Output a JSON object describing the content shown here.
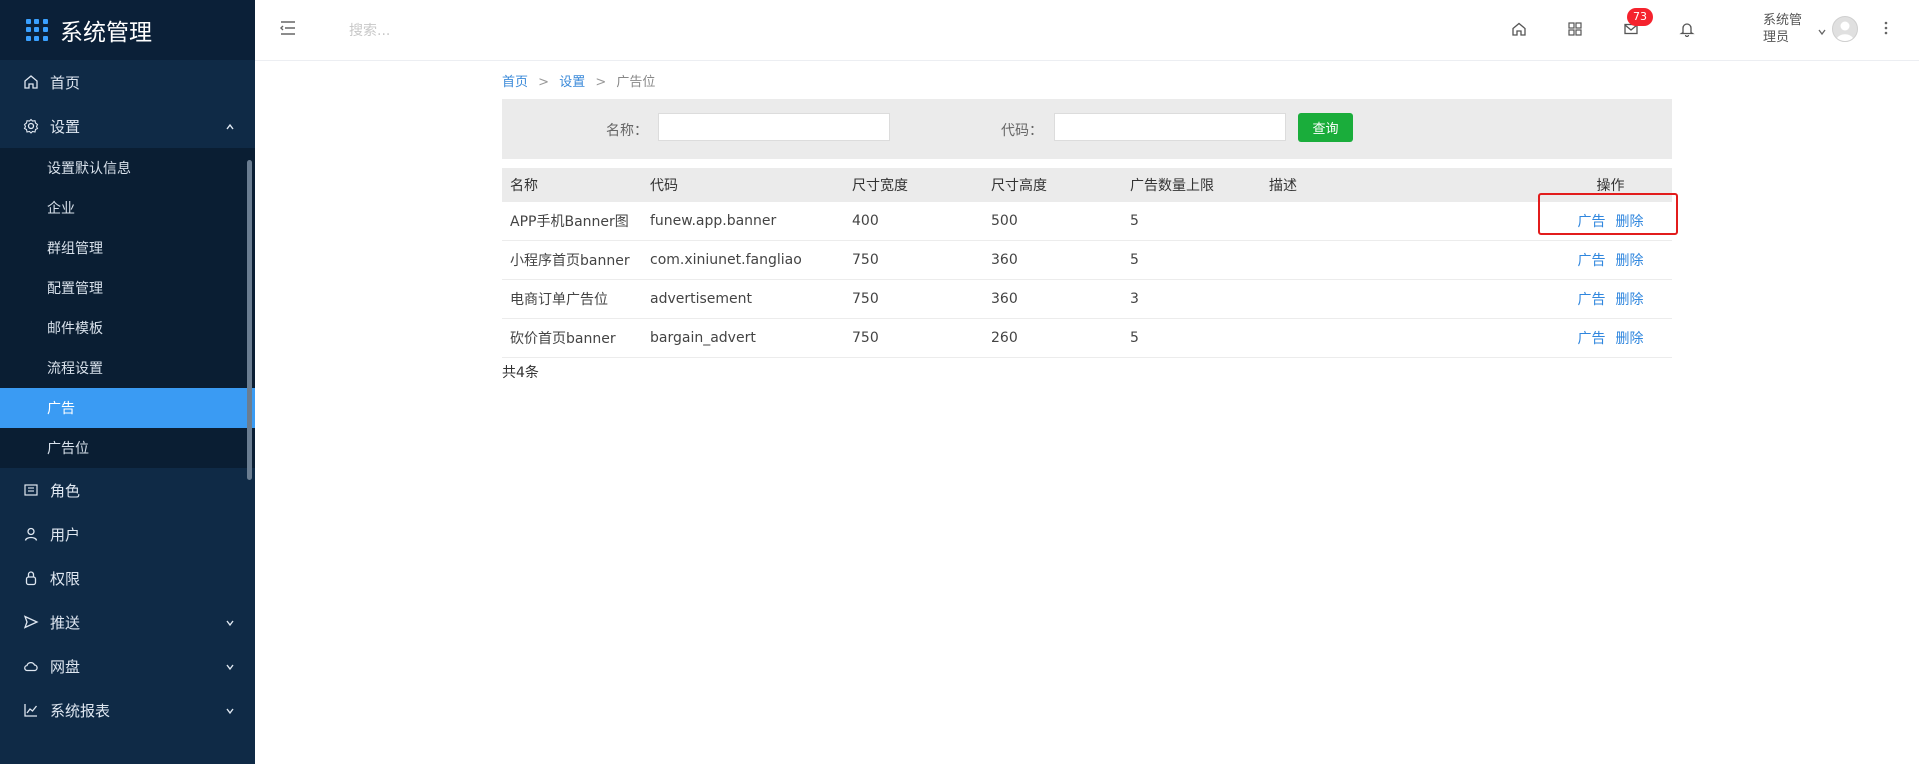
{
  "app": {
    "title": "系统管理"
  },
  "sidebar": {
    "items": [
      {
        "label": "首页",
        "icon": "home-icon"
      },
      {
        "label": "设置",
        "icon": "gear-icon",
        "expanded": true
      },
      {
        "label": "角色",
        "icon": "role-icon"
      },
      {
        "label": "用户",
        "icon": "user-icon"
      },
      {
        "label": "权限",
        "icon": "lock-icon"
      },
      {
        "label": "推送",
        "icon": "send-icon"
      },
      {
        "label": "网盘",
        "icon": "cloud-icon"
      },
      {
        "label": "系统报表",
        "icon": "chart-icon"
      }
    ],
    "settings_children": [
      {
        "label": "设置默认信息"
      },
      {
        "label": "企业"
      },
      {
        "label": "群组管理"
      },
      {
        "label": "配置管理"
      },
      {
        "label": "邮件模板"
      },
      {
        "label": "流程设置"
      },
      {
        "label": "广告",
        "active": true
      },
      {
        "label": "广告位"
      }
    ]
  },
  "header": {
    "search_placeholder": "搜索...",
    "mail_badge": "73",
    "user_name": "系统管理员",
    "icons": [
      "menu-toggle-icon",
      "home-icon",
      "apps-icon",
      "mail-icon",
      "bell-icon",
      "chevron-down-icon",
      "avatar",
      "more-vertical-icon"
    ]
  },
  "breadcrumb": {
    "home": "首页",
    "settings": "设置",
    "current": "广告位",
    "sep": ">"
  },
  "filter": {
    "name_label": "名称：",
    "code_label": "代码：",
    "name_value": "",
    "code_value": "",
    "query_button": "查询"
  },
  "table": {
    "columns": [
      "名称",
      "代码",
      "尺寸宽度",
      "尺寸高度",
      "广告数量上限",
      "描述",
      "操作"
    ],
    "rows": [
      {
        "name": "APP手机Banner图",
        "code": "funew.app.banner",
        "width": "400",
        "height": "500",
        "limit": "5",
        "desc": ""
      },
      {
        "name": "小程序首页banner",
        "code": "com.xiniunet.fangliao",
        "width": "750",
        "height": "360",
        "limit": "5",
        "desc": ""
      },
      {
        "name": "电商订单广告位",
        "code": "advertisement",
        "width": "750",
        "height": "360",
        "limit": "3",
        "desc": ""
      },
      {
        "name": "砍价首页banner",
        "code": "bargain_advert",
        "width": "750",
        "height": "260",
        "limit": "5",
        "desc": ""
      }
    ],
    "action_ad": "广告",
    "action_delete": "删除",
    "total": "共4条"
  },
  "colors": {
    "sidebar_bg": "#0f2a46",
    "active_item": "#3a9bf3",
    "link": "#2f86de",
    "query_button": "#1aad3b",
    "badge": "#f5222d",
    "highlight_box": "#e21c1c"
  }
}
